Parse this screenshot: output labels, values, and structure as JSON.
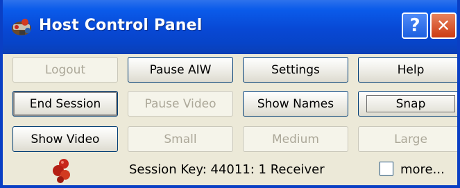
{
  "window": {
    "title": "Host Control Panel",
    "help_glyph": "?",
    "close_glyph": "✕",
    "icon": "host-app-icon"
  },
  "buttons": {
    "row1": [
      {
        "label": "Logout",
        "enabled": false
      },
      {
        "label": "Pause AIW",
        "enabled": true
      },
      {
        "label": "Settings",
        "enabled": true
      },
      {
        "label": "Help",
        "enabled": true
      }
    ],
    "row2": [
      {
        "label": "End Session",
        "enabled": true
      },
      {
        "label": "Pause Video",
        "enabled": false
      },
      {
        "label": "Show Names",
        "enabled": true
      },
      {
        "label": "Snap",
        "enabled": true
      }
    ],
    "row3": [
      {
        "label": "Show Video",
        "enabled": true
      },
      {
        "label": "Small",
        "enabled": false
      },
      {
        "label": "Medium",
        "enabled": false
      },
      {
        "label": "Large",
        "enabled": false
      }
    ]
  },
  "status": {
    "session_text": "Session Key: 44011: 1 Receiver",
    "more_label": "more...",
    "more_checked": false
  },
  "colors": {
    "titlebar": "#0848d4",
    "window_bg": "#ece9d8",
    "disabled_text": "#aca899"
  }
}
